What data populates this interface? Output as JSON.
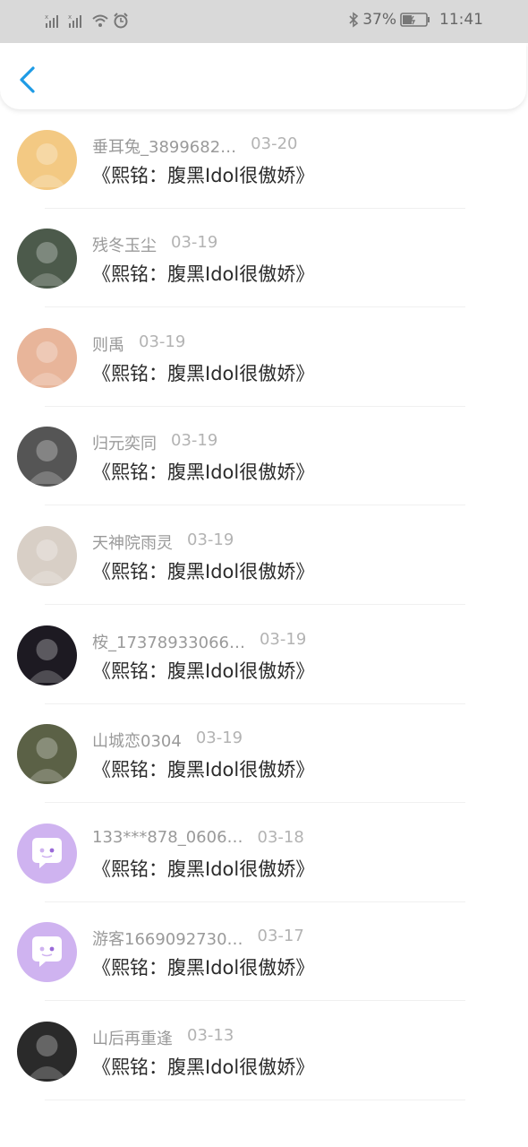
{
  "status_bar": {
    "battery": "37%",
    "time": "11:41",
    "icons": [
      "signal-x-icon",
      "signal-x-icon",
      "wifi-icon",
      "alarm-icon",
      "bluetooth-icon",
      "battery-icon"
    ]
  },
  "nav": {
    "back_icon": "chevron-left-icon",
    "accent": "#1e9be5"
  },
  "comments": [
    {
      "user": "",
      "date": "",
      "text": "《熙铭：腹黑Idol很傲娇》",
      "avatar": "#d9c8f0"
    },
    {
      "user": "垂耳兔_3899682…",
      "date": "03-20",
      "text": "《熙铭：腹黑Idol很傲娇》",
      "avatar": "#f3c983"
    },
    {
      "user": "残冬玉尘",
      "date": "03-19",
      "text": "《熙铭：腹黑Idol很傲娇》",
      "avatar": "#4c5a4b"
    },
    {
      "user": "则禹",
      "date": "03-19",
      "text": "《熙铭：腹黑Idol很傲娇》",
      "avatar": "#e8b59a"
    },
    {
      "user": "归元奕同",
      "date": "03-19",
      "text": "《熙铭：腹黑Idol很傲娇》",
      "avatar": "#555555"
    },
    {
      "user": "天神院雨灵",
      "date": "03-19",
      "text": "《熙铭：腹黑Idol很傲娇》",
      "avatar": "#d8cfc6"
    },
    {
      "user": "桉_17378933066…",
      "date": "03-19",
      "text": "《熙铭：腹黑Idol很傲娇》",
      "avatar": "#1d1a22"
    },
    {
      "user": "山城恋0304",
      "date": "03-19",
      "text": "《熙铭：腹黑Idol很傲娇》",
      "avatar": "#5b6146"
    },
    {
      "user": "133***878_0606…",
      "date": "03-18",
      "text": "《熙铭：腹黑Idol很傲娇》",
      "avatar": "#cfb3f0"
    },
    {
      "user": "游客1669092730…",
      "date": "03-17",
      "text": "《熙铭：腹黑Idol很傲娇》",
      "avatar": "#cfb3f0"
    },
    {
      "user": "山后再重逢",
      "date": "03-13",
      "text": "《熙铭：腹黑Idol很傲娇》",
      "avatar": "#2a2a2a"
    }
  ]
}
